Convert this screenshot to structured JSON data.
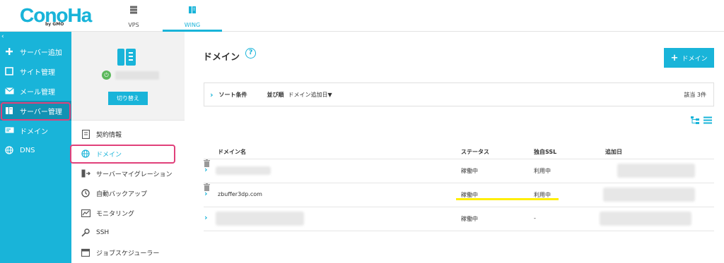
{
  "brand": {
    "logo": "ConoHa",
    "sub": "by GMO"
  },
  "top_nav": [
    {
      "label": "VPS",
      "icon": "server-stack-icon",
      "active": false
    },
    {
      "label": "WING",
      "icon": "wing-server-icon",
      "active": true
    }
  ],
  "sidebar": {
    "collapse": "‹",
    "items": [
      {
        "label": "サーバー追加",
        "icon": "plus-icon"
      },
      {
        "label": "サイト管理",
        "icon": "window-icon"
      },
      {
        "label": "メール管理",
        "icon": "mail-icon"
      },
      {
        "label": "サーバー管理",
        "icon": "server-icon",
        "active": true
      },
      {
        "label": "ドメイン",
        "icon": "domain-card-icon"
      },
      {
        "label": "DNS",
        "icon": "globe-icon"
      }
    ]
  },
  "panel": {
    "switch_label": "切り替え",
    "menu": [
      {
        "label": "契約情報",
        "icon": "contract-icon"
      },
      {
        "label": "ドメイン",
        "icon": "globe-icon",
        "active": true
      },
      {
        "label": "サーバーマイグレーション",
        "icon": "migration-icon"
      },
      {
        "label": "自動バックアップ",
        "icon": "backup-icon"
      },
      {
        "label": "モニタリング",
        "icon": "monitor-icon"
      },
      {
        "label": "SSH",
        "icon": "key-icon"
      },
      {
        "label": "ジョブスケジューラー",
        "icon": "calendar-icon"
      }
    ]
  },
  "main": {
    "title": "ドメイン",
    "help": "?",
    "add_button": "ドメイン",
    "sort": {
      "label": "ソート条件",
      "order_label": "並び順",
      "order_value": "ドメイン追加日▼",
      "count": "該当 3件"
    },
    "table": {
      "headers": [
        "ドメイン名",
        "ステータス",
        "独自SSL",
        "追加日"
      ],
      "rows": [
        {
          "domain": "",
          "status": "稼働中",
          "ssl": "利用中"
        },
        {
          "domain": "zbuffer3dp.com",
          "status": "稼働中",
          "ssl": "利用中"
        },
        {
          "domain": "",
          "status": "稼働中",
          "ssl": "-"
        }
      ]
    }
  },
  "colors": {
    "accent": "#19b4d9",
    "accent_dark": "#1291b3",
    "highlight": "#e0407a",
    "marker": "#ffee00"
  }
}
